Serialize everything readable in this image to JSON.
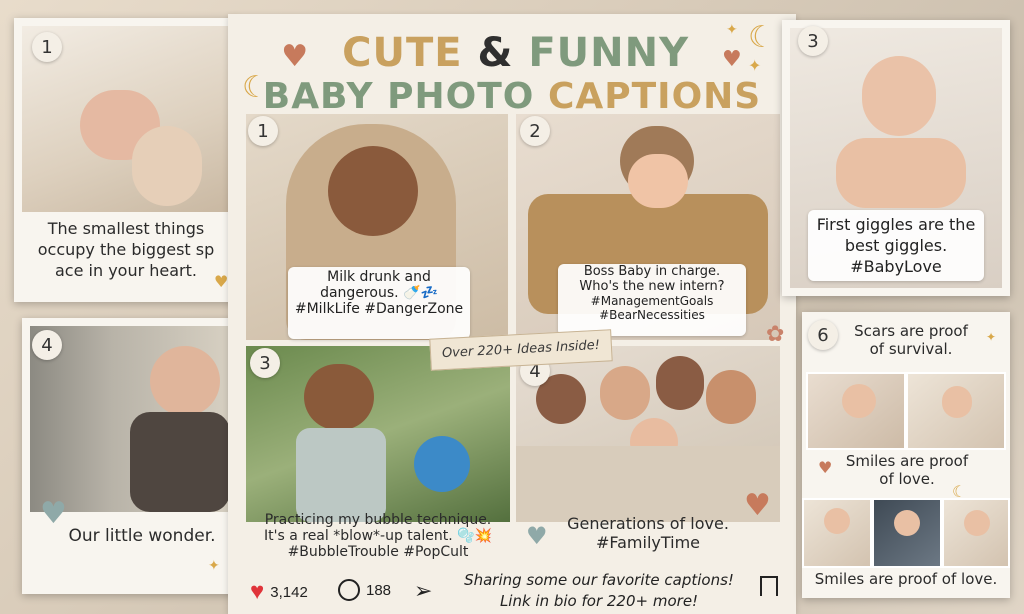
{
  "title": {
    "line1_a": "CUTE",
    "line1_amp": "&",
    "line1_b": "FUNNY",
    "line2_a": "BABY PHOTO",
    "line2_b": "CAPTIONS"
  },
  "colors": {
    "tan": "#c9a15f",
    "sage": "#7f9a7d",
    "brown": "#2f2f2f",
    "heart_red": "#e0343a"
  },
  "banner": "Over 220+ Ideas Inside!",
  "left_cards": [
    {
      "num": "1",
      "caption": "The smallest things occupy the biggest sp ace in your heart."
    },
    {
      "num": "4",
      "caption": "Our little wonder."
    }
  ],
  "right_cards": [
    {
      "num": "3",
      "caption": "First giggles are the best giggles. #BabyLove"
    },
    {
      "num": "6",
      "caption_top": "Scars are proof of survival.",
      "caption_mid": "Smiles are proof of love.",
      "caption_bottom": "Smiles are proof of love."
    }
  ],
  "center_cards": [
    {
      "num": "1",
      "line1": "Milk drunk and",
      "line2": "dangerous. 🍼💤",
      "line3": "#MilkLife #DangerZone"
    },
    {
      "num": "2",
      "line1": "Boss Baby in charge.",
      "line2": "Who's the new intern?",
      "line3": "#ManagementGoals",
      "line4": "#BearNecessities"
    },
    {
      "num": "3",
      "line1": "Practicing my bubble technique.",
      "line2": "It's a real *blow*-up talent. 🫧💥",
      "line3": "#BubbleTrouble #PopCult"
    },
    {
      "num": "4",
      "line1": "Generations of love.",
      "line2": "#FamilyTime"
    }
  ],
  "footer": {
    "likes": "3,142",
    "comments": "188",
    "message_line1": "Sharing some our favorite captions!",
    "message_line2": "Link in bio for 220+ more!"
  },
  "icons": [
    "heart-icon",
    "comment-icon",
    "send-icon",
    "bookmark-icon",
    "star-icon",
    "moon-icon"
  ]
}
